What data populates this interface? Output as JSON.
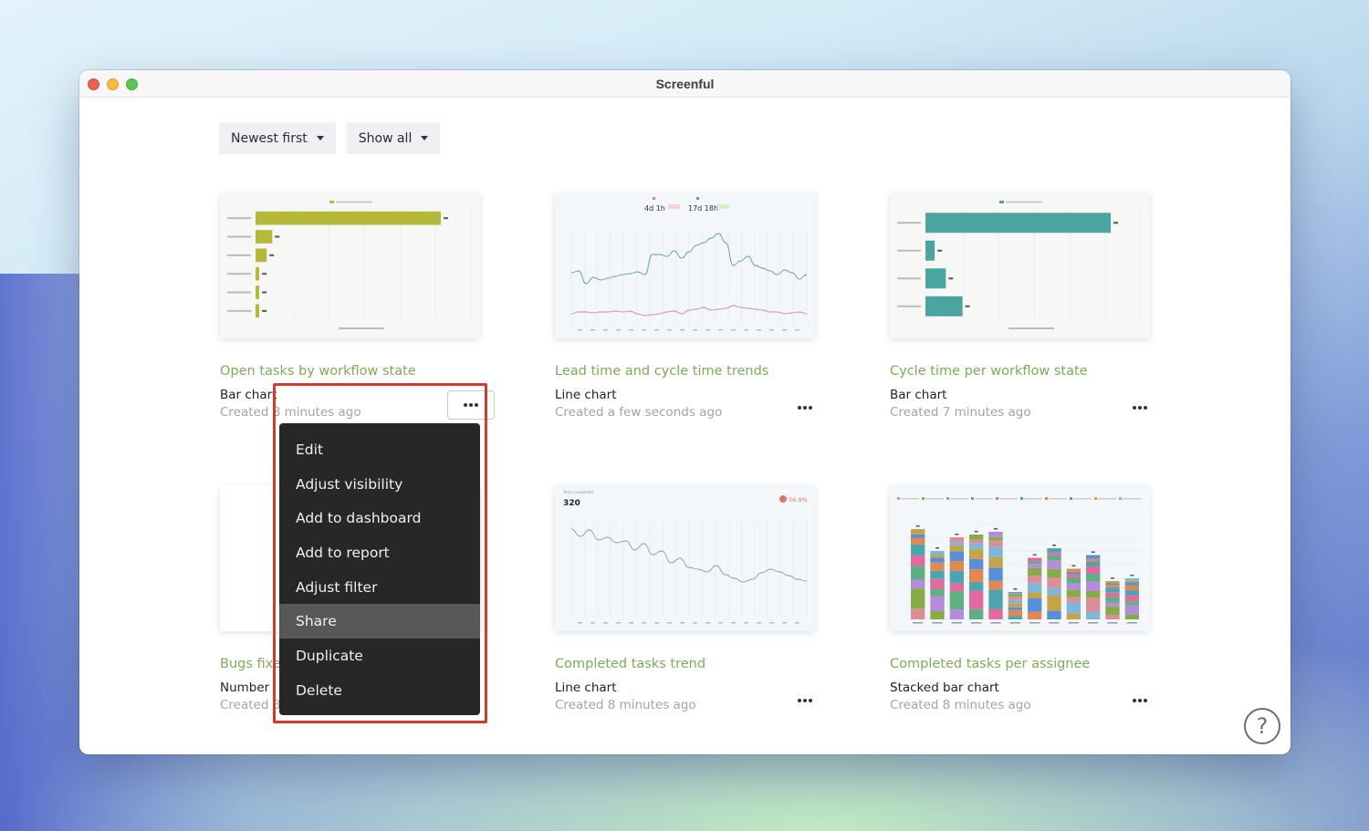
{
  "window": {
    "title": "Screenful"
  },
  "filters": {
    "sort": {
      "label": "Newest first"
    },
    "visibility": {
      "label": "Show all"
    }
  },
  "cards": [
    {
      "title": "Open tasks by workflow state",
      "type": "Bar chart",
      "created": "Created 8 minutes ago",
      "thumb": {
        "kind": "hbar",
        "color": "#b5b93b",
        "values": [
          100,
          9,
          6,
          2,
          2,
          2
        ]
      }
    },
    {
      "title": "Lead time and cycle time trends",
      "type": "Line chart",
      "created": "Created a few seconds ago",
      "thumb": {
        "kind": "dual-line",
        "cycle_time": "4d 1h",
        "lead_time": "17d 18h",
        "lead_color": "#5fa38d",
        "cycle_color": "#c98b8b"
      }
    },
    {
      "title": "Cycle time per workflow state",
      "type": "Bar chart",
      "created": "Created 7 minutes ago",
      "thumb": {
        "kind": "hbar",
        "color": "#4aa5a0",
        "values": [
          100,
          5,
          11,
          20
        ]
      }
    },
    {
      "title": "Bugs fixed",
      "type": "Number",
      "created": "Created 8 minutes ago",
      "thumb": {
        "kind": "blank"
      }
    },
    {
      "title": "Completed tasks trend",
      "type": "Line chart",
      "created": "Created 8 minutes ago",
      "thumb": {
        "kind": "single-line",
        "label": "Tasks completed",
        "value": "320",
        "change": "56.9%",
        "line_color": "#7ea3bf",
        "change_color": "#d2796d"
      }
    },
    {
      "title": "Completed tasks per assignee",
      "type": "Stacked bar chart",
      "created": "Created 8 minutes ago",
      "thumb": {
        "kind": "stacked",
        "colors": [
          "#d98f95",
          "#86ab49",
          "#b58bdc",
          "#5fae84",
          "#df6b9f",
          "#4aa5b0",
          "#e08752",
          "#5a8fd8",
          "#c2a44a",
          "#7eb7d9"
        ],
        "totals": [
          66,
          50,
          60,
          62,
          64,
          20,
          45,
          52,
          37,
          47,
          28,
          30
        ]
      }
    }
  ],
  "context_menu": {
    "items": [
      {
        "label": "Edit"
      },
      {
        "label": "Adjust visibility"
      },
      {
        "label": "Add to dashboard"
      },
      {
        "label": "Add to report"
      },
      {
        "label": "Adjust filter"
      },
      {
        "label": "Share",
        "hovered": true
      },
      {
        "label": "Duplicate"
      },
      {
        "label": "Delete"
      }
    ]
  },
  "help": {
    "label": "?"
  }
}
